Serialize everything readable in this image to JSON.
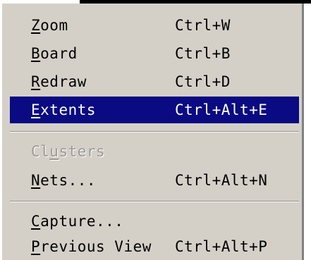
{
  "menu": {
    "items": [
      {
        "pre": "",
        "mn": "Z",
        "rest": "oom",
        "shortcut": "Ctrl+W"
      },
      {
        "pre": "",
        "mn": "B",
        "rest": "oard",
        "shortcut": "Ctrl+B"
      },
      {
        "pre": "",
        "mn": "R",
        "rest": "edraw",
        "shortcut": "Ctrl+D"
      },
      {
        "pre": "",
        "mn": "E",
        "rest": "xtents",
        "shortcut": "Ctrl+Alt+E"
      },
      {
        "pre": "Cl",
        "mn": "u",
        "rest": "sters",
        "shortcut": ""
      },
      {
        "pre": "",
        "mn": "N",
        "rest": "ets...",
        "shortcut": "Ctrl+Alt+N"
      },
      {
        "pre": "",
        "mn": "C",
        "rest": "apture...",
        "shortcut": ""
      },
      {
        "pre": "",
        "mn": "P",
        "rest": "revious View",
        "shortcut": "Ctrl+Alt+P"
      }
    ]
  },
  "colors": {
    "menu_background": "#d4d0c8",
    "selection_background": "#0a0a82",
    "selection_text": "#ffffff",
    "disabled_text": "#9c9a96"
  }
}
